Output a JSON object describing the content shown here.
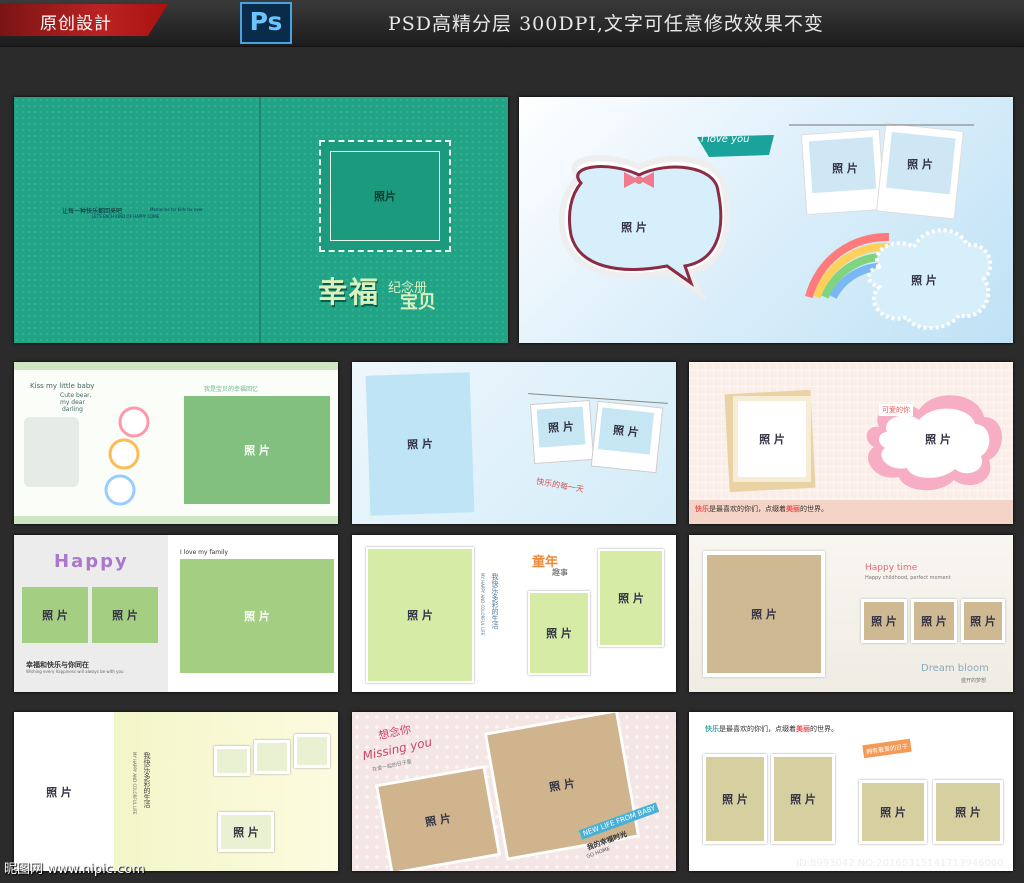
{
  "header": {
    "badge": "原创設計",
    "ps_logo": "Ps",
    "tagline": "PSD高精分层 300DPI,文字可任意修改效果不变"
  },
  "photo_label": "照 片",
  "photo_label_tight": "照片",
  "cover": {
    "small_text": "让每一种快乐都回来吧",
    "small_text_en1": "Memories for Kids for ever",
    "small_text_en2": "LETS EACH KIND OF HAPPY COME",
    "title_main": "幸福",
    "title_small": "纪念册",
    "title_end": "宝贝"
  },
  "spread1": {
    "bubble": "i love you"
  },
  "spread2": {
    "kiss": "Kiss my little baby",
    "cute1": "Cute bear,",
    "cute2": "my dear",
    "cute3": "darling",
    "head": "我是宝贝的幸福回忆"
  },
  "spread3": {
    "caption": "快乐的每一天"
  },
  "spread4": {
    "tag": "可爱的你",
    "foot_a": "快乐",
    "foot_b": "是最喜欢的你们，点缀着",
    "foot_c": "美丽",
    "foot_d": "的世界。"
  },
  "spread5": {
    "happy": "Happy",
    "love": "I love my family",
    "foot": "幸福和快乐与你同在",
    "foot_sub": "Wishing every happiness will always be with you"
  },
  "spread6": {
    "vertical": "我快乐多彩的生活",
    "vertical_en": "MY HAPPY AND COLORFUL LIFE",
    "title_a": "童年",
    "title_b": "趣事"
  },
  "spread7": {
    "happy_time": "Happy time",
    "sub": "Happy childhood, perfect moment",
    "dream": "Dream bloom",
    "dream_sub": "盛开的梦想"
  },
  "spread8": {
    "vertical": "我快乐多彩的生活",
    "vertical_en": "MY HAPPY AND COLORFUL LIFE"
  },
  "spread9": {
    "miss": "Missing you",
    "xiang": "想念你",
    "sub": "在爱一起的日子里",
    "new_life": "NEW LIFE FROM BABY",
    "wode": "我的幸福时光",
    "go_home": "GO HOME"
  },
  "spread10": {
    "foot_a": "快乐",
    "foot_b": "是最喜欢的你们，点缀着",
    "foot_c": "美丽",
    "foot_d": "的世界。",
    "tag": "拥有着爱的日子"
  },
  "watermark": {
    "left": "昵图网 www.nipic.com",
    "right": "ID:8993042 NO:20160315141713946000"
  }
}
